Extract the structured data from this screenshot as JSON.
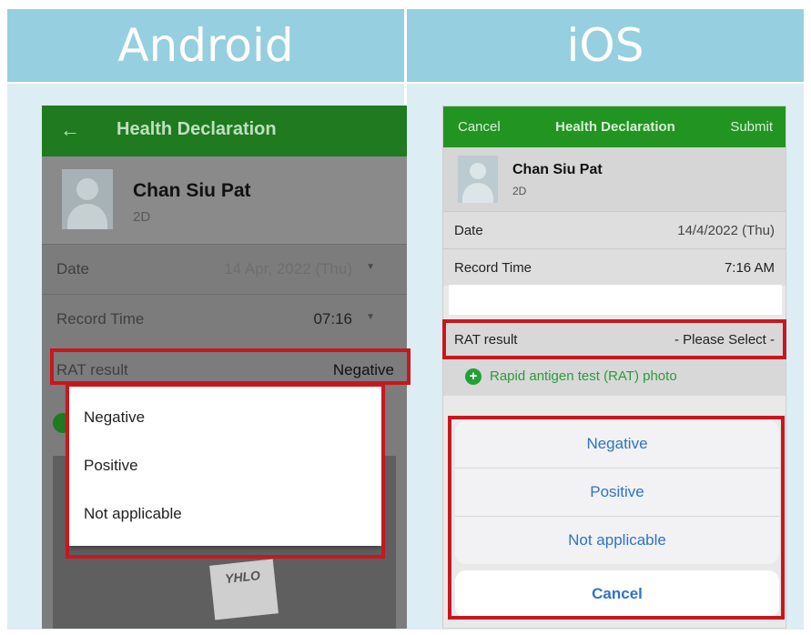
{
  "headers": {
    "left": "Android",
    "right": "iOS"
  },
  "android": {
    "title": "Health Declaration",
    "back_icon": "arrow-left-icon",
    "profile": {
      "name": "Chan Siu Pat",
      "class": "2D"
    },
    "date": {
      "label": "Date",
      "value": "14 Apr, 2022 (Thu)"
    },
    "record_time": {
      "label": "Record Time",
      "value": "07:16"
    },
    "rat": {
      "label": "RAT result",
      "value": "Negative"
    },
    "dropdown_options": [
      "Negative",
      "Positive",
      "Not applicable"
    ],
    "photo_tag": "YHLO"
  },
  "ios": {
    "nav": {
      "cancel": "Cancel",
      "title": "Health Declaration",
      "submit": "Submit"
    },
    "profile": {
      "name": "Chan Siu Pat",
      "class": "2D"
    },
    "date": {
      "label": "Date",
      "value": "14/4/2022 (Thu)"
    },
    "record_time": {
      "label": "Record Time",
      "value": "7:16 AM"
    },
    "rat": {
      "label": "RAT result",
      "value": "- Please Select -"
    },
    "photo_link": "Rapid antigen test (RAT) photo",
    "sheet_options": [
      "Negative",
      "Positive",
      "Not applicable"
    ],
    "sheet_cancel": "Cancel"
  },
  "colors": {
    "header": "#96cfdf",
    "android_bar": "#1f7a20",
    "ios_bar": "#229422",
    "highlight": "#c8171e",
    "ios_action": "#2f73c6"
  }
}
